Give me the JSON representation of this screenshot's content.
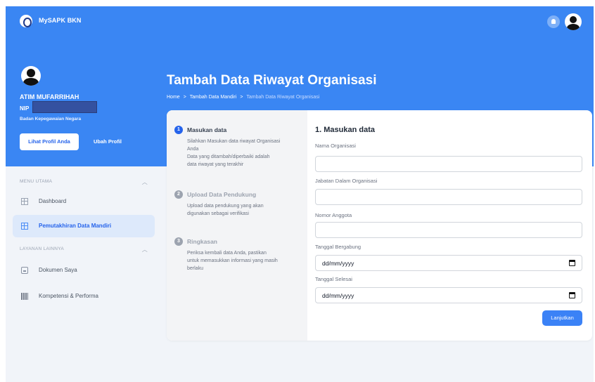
{
  "header": {
    "app_title": "MySAPK BKN"
  },
  "profile": {
    "name": "ATIM MUFARRIHAH",
    "nip_label": "NIP",
    "organization": "Badan Kepegawaian Negara",
    "view_profile_label": "Lihat Profil Anda",
    "edit_profile_label": "Ubah Profil"
  },
  "page": {
    "title": "Tambah Data Riwayat Organisasi",
    "breadcrumb": [
      "Home",
      "Tambah Data Mandiri",
      "Tambah Data Riwayat Organisasi"
    ],
    "breadcrumb_sep": ">"
  },
  "sidebar": {
    "sections": [
      {
        "title": "MENU UTAMA",
        "items": [
          {
            "label": "Dashboard",
            "icon": "grid-icon",
            "active": false
          },
          {
            "label": "Pemutakhiran Data Mandiri",
            "icon": "grid-icon",
            "active": true
          }
        ]
      },
      {
        "title": "LAYANAN LAINNYA",
        "items": [
          {
            "label": "Dokumen Saya",
            "icon": "document-icon",
            "active": false
          },
          {
            "label": "Kompetensi & Performa",
            "icon": "chart-icon",
            "active": false
          }
        ]
      }
    ]
  },
  "steps": [
    {
      "number": "1",
      "title": "Masukan data",
      "active": true,
      "desc": [
        "Silahkan Masukan data riwayat Organisasi",
        "Anda",
        "Data yang ditambah/diperbaiki adalah",
        "data riwayat yang terakhir"
      ]
    },
    {
      "number": "2",
      "title": "Upload Data Pendukung",
      "active": false,
      "desc": [
        "Upload data pendukung yang akan",
        "digunakan sebagai verifikasi"
      ]
    },
    {
      "number": "3",
      "title": "Ringkasan",
      "active": false,
      "desc": [
        "Periksa kembali data Anda, pastikan",
        "untuk memasukkan informasi yang masih",
        "berlaku"
      ]
    }
  ],
  "form": {
    "heading": "1. Masukan data",
    "fields": [
      {
        "label": "Nama Organisasi",
        "value": ""
      },
      {
        "label": "Jabatan Dalam Organisasi",
        "value": ""
      },
      {
        "label": "Nomor Anggota",
        "value": ""
      },
      {
        "label": "Tanggal Bergabung",
        "value": "dd/mm/yyyy"
      },
      {
        "label": "Tanggal Selesai",
        "value": "dd/mm/yyyy"
      }
    ],
    "submit_label": "Lanjutkan"
  },
  "colors": {
    "primary": "#3a86f3",
    "accent": "#2563eb",
    "background": "#f1f4f9"
  }
}
